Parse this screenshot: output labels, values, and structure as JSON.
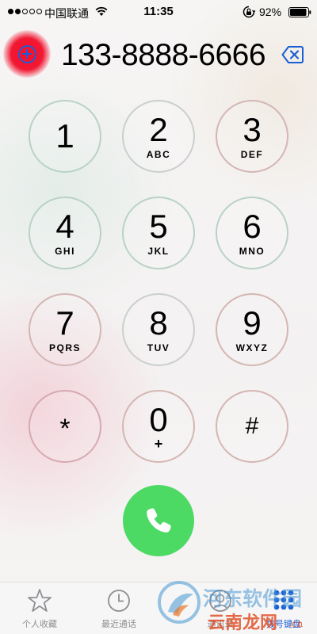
{
  "status_bar": {
    "signal_strength": "2 of 5",
    "carrier": "中国联通",
    "time": "11:35",
    "battery_percent": "92%",
    "icons": [
      "signal-dots-icon",
      "wifi-icon",
      "rotation-lock-icon",
      "battery-icon"
    ]
  },
  "dialer": {
    "number": "133-8888-6666",
    "add_contact_icon": "plus-circle-icon",
    "delete_icon": "delete-backspace-icon"
  },
  "keypad": [
    {
      "digit": "1",
      "letters": ""
    },
    {
      "digit": "2",
      "letters": "ABC"
    },
    {
      "digit": "3",
      "letters": "DEF"
    },
    {
      "digit": "4",
      "letters": "GHI"
    },
    {
      "digit": "5",
      "letters": "JKL"
    },
    {
      "digit": "6",
      "letters": "MNO"
    },
    {
      "digit": "7",
      "letters": "PQRS"
    },
    {
      "digit": "8",
      "letters": "TUV"
    },
    {
      "digit": "9",
      "letters": "WXYZ"
    },
    {
      "digit": "*",
      "letters": ""
    },
    {
      "digit": "0",
      "letters": "+"
    },
    {
      "digit": "#",
      "letters": ""
    }
  ],
  "call_button": {
    "icon": "phone-icon",
    "color": "#4cd964"
  },
  "tabs": [
    {
      "label": "个人收藏",
      "icon": "star-icon",
      "active": false
    },
    {
      "label": "最近通话",
      "icon": "clock-icon",
      "active": false
    },
    {
      "label": "通讯录",
      "icon": "contacts-icon",
      "active": false
    },
    {
      "label": "拨号键盘",
      "icon": "keypad-icon",
      "active": true
    }
  ],
  "watermark": {
    "line1": "河东软件园",
    "line2": "云南龙网",
    "domain": ".cn"
  },
  "colors": {
    "accent": "#1a5ed6",
    "call_green": "#4cd964",
    "highlight_red": "#f0001e",
    "tab_inactive": "#8e8e93"
  }
}
